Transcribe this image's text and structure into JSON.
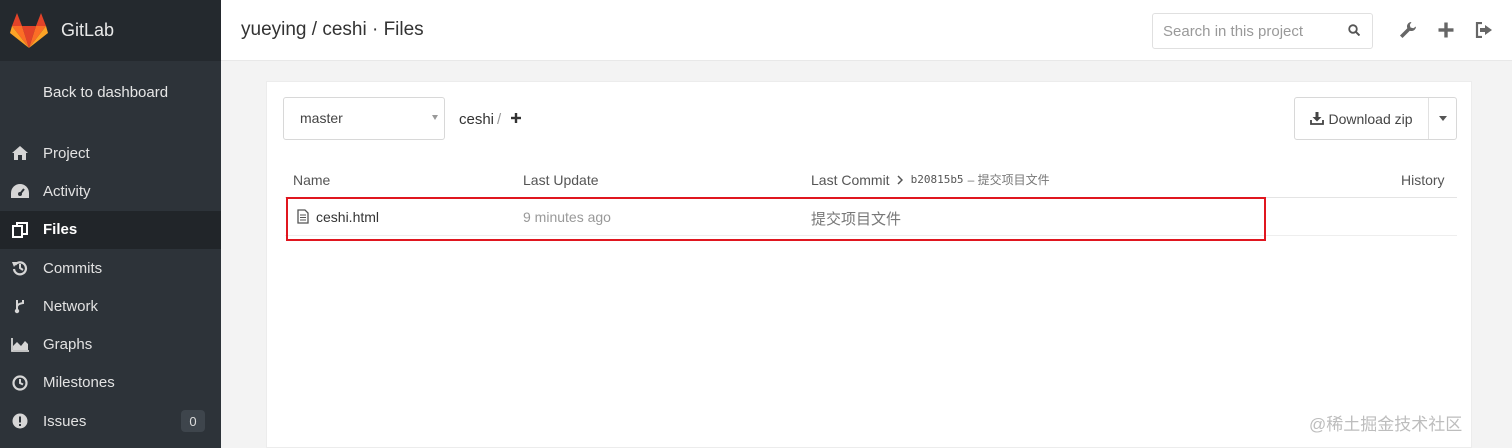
{
  "sidebar": {
    "brand": "GitLab",
    "back_link": "Back to dashboard",
    "items": [
      {
        "label": "Project",
        "icon": "home-icon"
      },
      {
        "label": "Activity",
        "icon": "dashboard-icon"
      },
      {
        "label": "Files",
        "icon": "copy-files-icon",
        "active": true
      },
      {
        "label": "Commits",
        "icon": "history-icon"
      },
      {
        "label": "Network",
        "icon": "branch-icon"
      },
      {
        "label": "Graphs",
        "icon": "area-chart-icon"
      },
      {
        "label": "Milestones",
        "icon": "clock-icon"
      },
      {
        "label": "Issues",
        "icon": "exclamation-circle-icon",
        "badge": "0"
      }
    ]
  },
  "header": {
    "title": "yueying / ceshi · Files",
    "search_placeholder": "Search in this project"
  },
  "repo": {
    "branch": "master",
    "path": "ceshi",
    "path_separator": "/",
    "download_label": "Download zip"
  },
  "table": {
    "headers": {
      "name": "Name",
      "last_update": "Last Update",
      "last_commit": "Last Commit",
      "history": "History"
    },
    "last_commit_hash": "b20815b5",
    "last_commit_message": "– 提交项目文件",
    "rows": [
      {
        "name": "ceshi.html",
        "last_update": "9 minutes ago",
        "message": "提交项目文件"
      }
    ]
  },
  "watermark": "@稀土掘金技术社区",
  "colors": {
    "sidebar_bg": "#2d3339",
    "highlight": "#e0161f",
    "brand_orange": "#fc6d26"
  }
}
